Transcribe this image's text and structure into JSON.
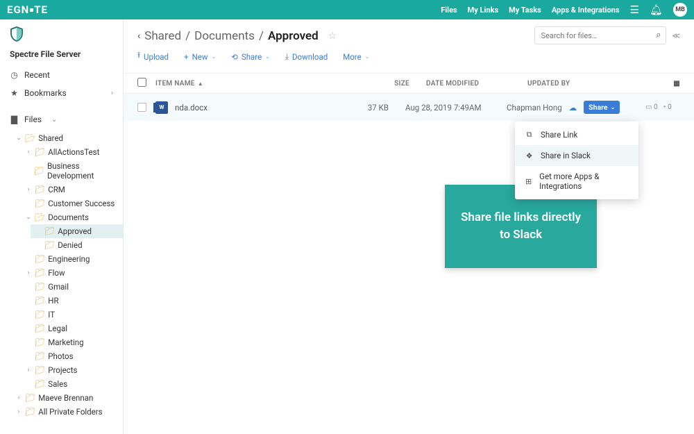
{
  "brand": "EGNYTE",
  "topnav": {
    "files": "Files",
    "mylinks": "My Links",
    "mytasks": "My Tasks",
    "apps": "Apps & Integrations"
  },
  "avatar": "MB",
  "sidebar": {
    "server_name": "Spectre File Server",
    "recent": "Recent",
    "bookmarks": "Bookmarks",
    "files": "Files",
    "tree": {
      "shared": "Shared",
      "allactions": "AllActionsTest",
      "bizdev": "Business Development",
      "crm": "CRM",
      "custsuccess": "Customer Success",
      "documents": "Documents",
      "approved": "Approved",
      "denied": "Denied",
      "engineering": "Engineering",
      "flow": "Flow",
      "gmail": "Gmail",
      "hr": "HR",
      "it": "IT",
      "legal": "Legal",
      "marketing": "Marketing",
      "photos": "Photos",
      "projects": "Projects",
      "sales": "Sales",
      "maeve": "Maeve Brennan",
      "allprivate": "All Private Folders"
    }
  },
  "breadcrumb": {
    "p1": "Shared",
    "p2": "Documents",
    "p3": "Approved"
  },
  "actions": {
    "upload": "Upload",
    "new": "New",
    "share": "Share",
    "download": "Download",
    "more": "More"
  },
  "search_placeholder": "Search for files…",
  "columns": {
    "name": "ITEM NAME",
    "size": "SIZE",
    "date": "DATE MODIFIED",
    "upd": "UPDATED BY"
  },
  "row": {
    "icon_label": "W",
    "name": "nda.docx",
    "size": "37 KB",
    "date": "Aug 28, 2019 7:49AM",
    "updated_by": "Chapman Hong",
    "share_label": "Share",
    "comments": "0",
    "tasks": "0"
  },
  "dropdown": {
    "link": "Share Link",
    "slack": "Share in Slack",
    "apps": "Get more Apps & Integrations"
  },
  "callout": "Share file links directly to Slack"
}
